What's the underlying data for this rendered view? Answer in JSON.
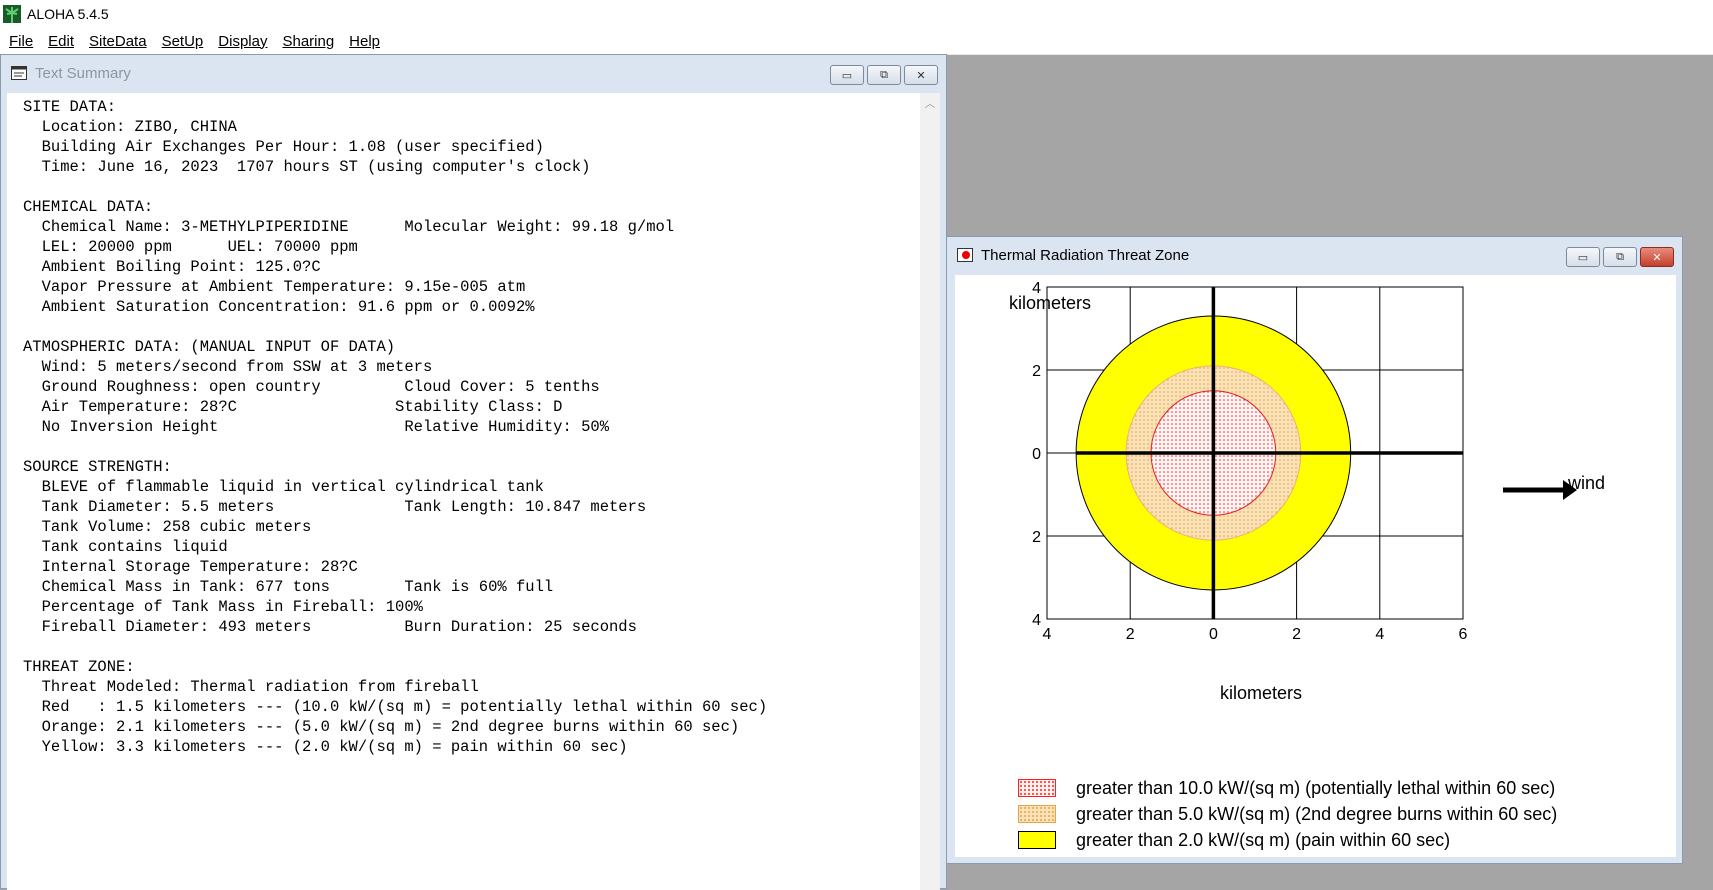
{
  "app": {
    "title": "ALOHA 5.4.5",
    "menu": [
      "File",
      "Edit",
      "SiteData",
      "SetUp",
      "Display",
      "Sharing",
      "Help"
    ]
  },
  "text_window": {
    "title": "Text Summary",
    "lines": [
      "SITE DATA:",
      "  Location: ZIBO, CHINA",
      "  Building Air Exchanges Per Hour: 1.08 (user specified)",
      "  Time: June 16, 2023  1707 hours ST (using computer's clock)",
      "",
      "CHEMICAL DATA:",
      "  Chemical Name: 3-METHYLPIPERIDINE      Molecular Weight: 99.18 g/mol",
      "  LEL: 20000 ppm      UEL: 70000 ppm",
      "  Ambient Boiling Point: 125.0?C",
      "  Vapor Pressure at Ambient Temperature: 9.15e-005 atm",
      "  Ambient Saturation Concentration: 91.6 ppm or 0.0092%",
      "",
      "ATMOSPHERIC DATA: (MANUAL INPUT OF DATA)",
      "  Wind: 5 meters/second from SSW at 3 meters",
      "  Ground Roughness: open country         Cloud Cover: 5 tenths",
      "  Air Temperature: 28?C                 Stability Class: D",
      "  No Inversion Height                    Relative Humidity: 50%",
      "",
      "SOURCE STRENGTH:",
      "  BLEVE of flammable liquid in vertical cylindrical tank",
      "  Tank Diameter: 5.5 meters              Tank Length: 10.847 meters",
      "  Tank Volume: 258 cubic meters",
      "  Tank contains liquid",
      "  Internal Storage Temperature: 28?C",
      "  Chemical Mass in Tank: 677 tons        Tank is 60% full",
      "  Percentage of Tank Mass in Fireball: 100%",
      "  Fireball Diameter: 493 meters          Burn Duration: 25 seconds",
      "",
      "THREAT ZONE:",
      "  Threat Modeled: Thermal radiation from fireball",
      "  Red   : 1.5 kilometers --- (10.0 kW/(sq m) = potentially lethal within 60 sec)",
      "  Orange: 2.1 kilometers --- (5.0 kW/(sq m) = 2nd degree burns within 60 sec)",
      "  Yellow: 3.3 kilometers --- (2.0 kW/(sq m) = pain within 60 sec)"
    ]
  },
  "thermal_window": {
    "title": "Thermal Radiation Threat Zone",
    "wind_label": "wind",
    "legend": [
      {
        "label": "greater than 10.0 kW/(sq m) (potentially lethal within 60 sec)",
        "color": "#ff0000"
      },
      {
        "label": "greater than 5.0 kW/(sq m) (2nd degree burns within 60 sec)",
        "color": "#f5c882"
      },
      {
        "label": "greater than 2.0 kW/(sq m) (pain within 60 sec)",
        "color": "#ffff00"
      }
    ]
  },
  "chart_data": {
    "type": "threat-zone",
    "ylabel": "kilometers",
    "xlabel": "kilometers",
    "x_ticks": [
      "4",
      "2",
      "0",
      "2",
      "4",
      "6"
    ],
    "x_tick_values": [
      -4,
      -2,
      0,
      2,
      4,
      6
    ],
    "y_ticks": [
      "4",
      "2",
      "0",
      "2",
      "4"
    ],
    "y_tick_values": [
      4,
      2,
      0,
      -2,
      -4
    ],
    "xlim": [
      -4,
      6
    ],
    "ylim": [
      -4,
      4
    ],
    "grid": true,
    "zones": [
      {
        "name": "yellow",
        "radius_km": 3.3,
        "color": "#ffff00"
      },
      {
        "name": "orange",
        "radius_km": 2.1,
        "color": "#f5c882"
      },
      {
        "name": "red",
        "radius_km": 1.5,
        "color": "#ff0000"
      }
    ]
  }
}
